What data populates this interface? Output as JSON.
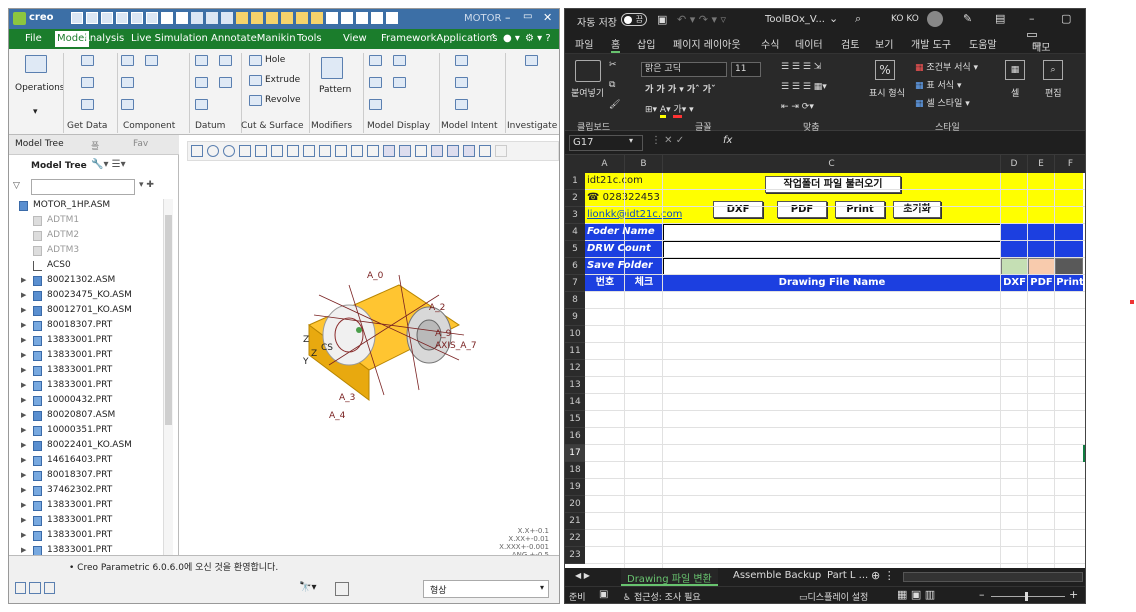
{
  "creo": {
    "title": "MOTOR",
    "menu": [
      "File",
      "Model",
      "Analysis",
      "Live Simulation",
      "AnnotateManikin",
      "Tools",
      "View",
      "FrameworkApplications"
    ],
    "ribbon": {
      "operations": "Operations",
      "get_data": "Get Data",
      "component": "Component",
      "datum": "Datum",
      "cut_surface": "Cut & Surface",
      "hole": "Hole",
      "extrude": "Extrude",
      "revolve": "Revolve",
      "pattern": "Pattern",
      "modifiers": "Modifiers",
      "model_display": "Model Display",
      "model_intent": "Model Intent",
      "investigate": "Investigate"
    },
    "tree_tab1": "Model Tree",
    "tree_tab2": "폴",
    "tree_tab3": "Fav",
    "tree_header": "Model Tree",
    "tree_items": [
      {
        "label": "MOTOR_1HP.ASM",
        "kind": "asm",
        "arrow": false,
        "dim": false
      },
      {
        "label": "ADTM1",
        "kind": "datum",
        "arrow": false,
        "dim": true
      },
      {
        "label": "ADTM2",
        "kind": "datum",
        "arrow": false,
        "dim": true
      },
      {
        "label": "ADTM3",
        "kind": "datum",
        "arrow": false,
        "dim": true
      },
      {
        "label": "ACS0",
        "kind": "csys",
        "arrow": false,
        "dim": false
      },
      {
        "label": "80021302.ASM",
        "kind": "asm",
        "arrow": true,
        "dim": false
      },
      {
        "label": "80023475_KO.ASM",
        "kind": "asm",
        "arrow": true,
        "dim": false
      },
      {
        "label": "80012701_KO.ASM",
        "kind": "asm",
        "arrow": true,
        "dim": false
      },
      {
        "label": "80018307.PRT",
        "kind": "prt",
        "arrow": true,
        "dim": false
      },
      {
        "label": "13833001.PRT",
        "kind": "prt",
        "arrow": true,
        "dim": false
      },
      {
        "label": "13833001.PRT",
        "kind": "prt",
        "arrow": true,
        "dim": false
      },
      {
        "label": "13833001.PRT",
        "kind": "prt",
        "arrow": true,
        "dim": false
      },
      {
        "label": "13833001.PRT",
        "kind": "prt",
        "arrow": true,
        "dim": false
      },
      {
        "label": "10000432.PRT",
        "kind": "prt",
        "arrow": true,
        "dim": false
      },
      {
        "label": "80020807.ASM",
        "kind": "asm",
        "arrow": true,
        "dim": false
      },
      {
        "label": "10000351.PRT",
        "kind": "prt",
        "arrow": true,
        "dim": false
      },
      {
        "label": "80022401_KO.ASM",
        "kind": "asm",
        "arrow": true,
        "dim": false
      },
      {
        "label": "14616403.PRT",
        "kind": "prt",
        "arrow": true,
        "dim": false
      },
      {
        "label": "80018307.PRT",
        "kind": "prt",
        "arrow": true,
        "dim": false
      },
      {
        "label": "37462302.PRT",
        "kind": "prt",
        "arrow": true,
        "dim": false
      },
      {
        "label": "13833001.PRT",
        "kind": "prt",
        "arrow": true,
        "dim": false
      },
      {
        "label": "13833001.PRT",
        "kind": "prt",
        "arrow": true,
        "dim": false
      },
      {
        "label": "13833001.PRT",
        "kind": "prt",
        "arrow": true,
        "dim": false
      },
      {
        "label": "13833001.PRT",
        "kind": "prt",
        "arrow": true,
        "dim": false
      }
    ],
    "view_labels": {
      "a0": "A_0",
      "a2": "A_2",
      "a9": "A_9",
      "axis7": "AXIS_A_7",
      "a3": "A_3",
      "a4": "A_4",
      "z1": "Z",
      "z2": "Z",
      "y": "Y",
      "cs": "CS"
    },
    "tolerances": [
      "X.X+-0.1",
      "X.XX+-0.01",
      "X.XXX+-0.001",
      "ANG.+-0.5"
    ],
    "status_msg": "• Creo Parametric 6.0.6.0에 오신 것을 환영합니다.",
    "filter_value": "형상"
  },
  "excel": {
    "autosave": "자동 저장",
    "autosave_state": "끔",
    "doc_name": "ToolBOx_V...",
    "user": "KO KO",
    "menu": [
      "파일",
      "홈",
      "삽입",
      "페이지 레이아웃",
      "수식",
      "데이터",
      "검토",
      "보기",
      "개발 도구",
      "도움말"
    ],
    "memo": "메모",
    "ribbon": {
      "paste": "붙여넣기",
      "clipboard": "클립보드",
      "font_name": "맑은 고딕",
      "font_size": "11",
      "font_group": "글꼴",
      "align_group": "맞춤",
      "number_format": "표시 형식",
      "cond_format": "조건부 서식",
      "table_format": "표 서식",
      "cell_style": "셀 스타일",
      "style_group": "스타일",
      "cells": "셀",
      "edit": "편집"
    },
    "name_box": "G17",
    "fx": "fx",
    "columns": [
      "A",
      "B",
      "C",
      "D",
      "E",
      "F"
    ],
    "rows": [
      "1",
      "2",
      "3",
      "4",
      "5",
      "6",
      "7",
      "8",
      "9",
      "10",
      "11",
      "12",
      "13",
      "14",
      "15",
      "16",
      "17",
      "18",
      "19",
      "20",
      "21",
      "22",
      "23"
    ],
    "cells": {
      "site": "idt21c.com",
      "phone": "☎ 028322453",
      "email": "lionkk@idt21c.com",
      "folder_name": "Foder Name",
      "drw_count": "DRW Count",
      "save_folder": "Save Folder",
      "hdr_no": "번호",
      "hdr_check": "체크",
      "hdr_name": "Drawing File Name",
      "hdr_dxf": "DXF",
      "hdr_pdf": "PDF",
      "hdr_print": "Print"
    },
    "buttons": {
      "load": "작업폴더 파일 불러오기",
      "dxf": "DXF",
      "pdf": "PDF",
      "print": "Print",
      "reset": "초기화"
    },
    "sheet_tabs": [
      "Drawing 파일 변환",
      "Assemble Backup",
      "Part L ..."
    ],
    "status_ready": "준비",
    "status_access": "접근성: 조사 필요",
    "status_display": "디스플레이 설정",
    "colors": {
      "yellow": "#ffff00",
      "blue": "#1c3fe0",
      "green": "#c5dfb4",
      "peach": "#f8cbad",
      "gray": "#595959"
    }
  }
}
